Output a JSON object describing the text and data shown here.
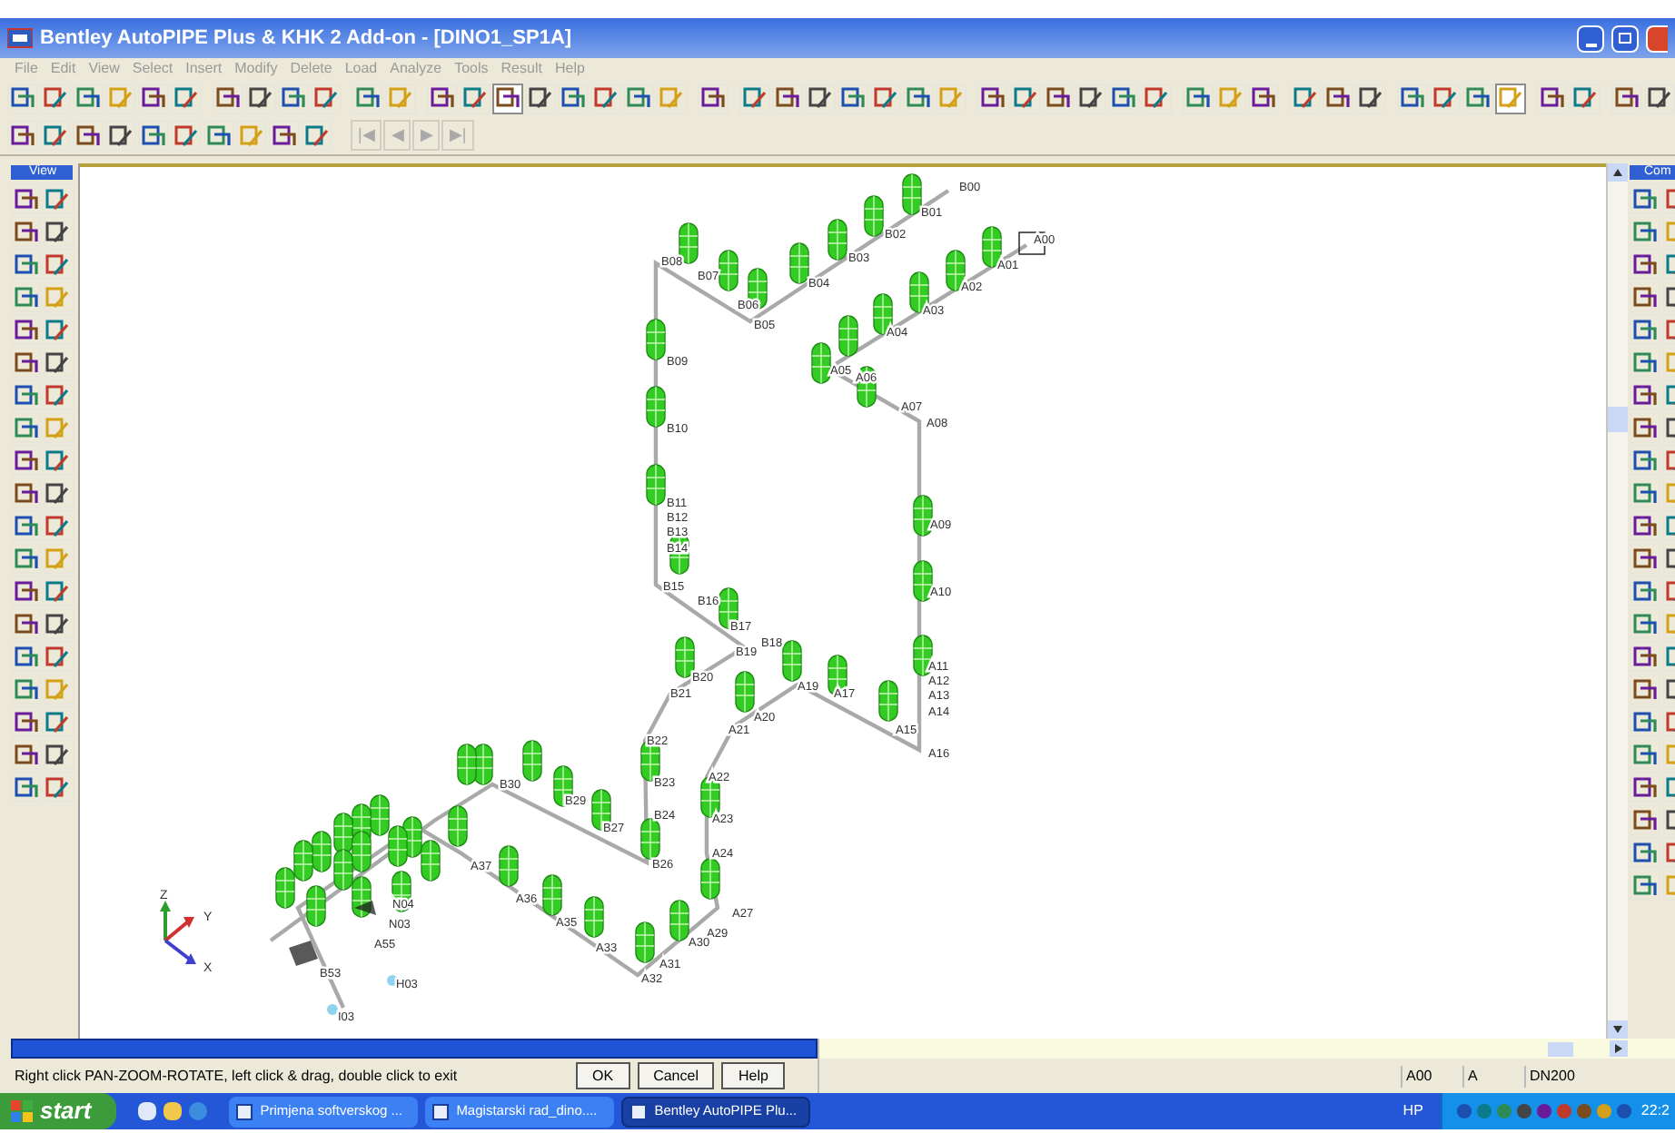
{
  "window": {
    "title": "Bentley AutoPIPE Plus & KHK 2 Add-on - [DINO1_SP1A]"
  },
  "menu": [
    "File",
    "Edit",
    "View",
    "Select",
    "Insert",
    "Modify",
    "Delete",
    "Load",
    "Analyze",
    "Tools",
    "Result",
    "Help"
  ],
  "toolbar_nav": [
    {
      "label": "|◀",
      "disabled": true
    },
    {
      "label": "◀",
      "disabled": true
    },
    {
      "label": "▶",
      "disabled": true
    },
    {
      "label": "▶|",
      "disabled": true
    }
  ],
  "left_panel": {
    "title": "View"
  },
  "right_panel": {
    "title": "Com"
  },
  "axes": [
    "Z",
    "Y",
    "X"
  ],
  "nodes": [
    {
      "label": "B00"
    },
    {
      "label": "B01"
    },
    {
      "label": "B02"
    },
    {
      "label": "B03"
    },
    {
      "label": "B04"
    },
    {
      "label": "B05"
    },
    {
      "label": "B06"
    },
    {
      "label": "B07"
    },
    {
      "label": "B08"
    },
    {
      "label": "B09"
    },
    {
      "label": "B10"
    },
    {
      "label": "B11"
    },
    {
      "label": "B12"
    },
    {
      "label": "B13"
    },
    {
      "label": "B14"
    },
    {
      "label": "B15"
    },
    {
      "label": "B16"
    },
    {
      "label": "B17"
    },
    {
      "label": "B18"
    },
    {
      "label": "B19"
    },
    {
      "label": "B20"
    },
    {
      "label": "B21"
    },
    {
      "label": "B22"
    },
    {
      "label": "B23"
    },
    {
      "label": "B24"
    },
    {
      "label": "B26"
    },
    {
      "label": "B27"
    },
    {
      "label": "B29"
    },
    {
      "label": "B30"
    },
    {
      "label": "A00"
    },
    {
      "label": "A01"
    },
    {
      "label": "A02"
    },
    {
      "label": "A03"
    },
    {
      "label": "A04"
    },
    {
      "label": "A05"
    },
    {
      "label": "A06"
    },
    {
      "label": "A07"
    },
    {
      "label": "A08"
    },
    {
      "label": "A09"
    },
    {
      "label": "A10"
    },
    {
      "label": "A11"
    },
    {
      "label": "A12"
    },
    {
      "label": "A13"
    },
    {
      "label": "A14"
    },
    {
      "label": "A15"
    },
    {
      "label": "A16"
    },
    {
      "label": "A17"
    },
    {
      "label": "A19"
    },
    {
      "label": "A20"
    },
    {
      "label": "A21"
    },
    {
      "label": "A22"
    },
    {
      "label": "A23"
    },
    {
      "label": "A24"
    },
    {
      "label": "A27"
    },
    {
      "label": "A29"
    },
    {
      "label": "A30"
    },
    {
      "label": "A31"
    },
    {
      "label": "A32"
    },
    {
      "label": "A33"
    },
    {
      "label": "A35"
    },
    {
      "label": "A36"
    },
    {
      "label": "A37"
    },
    {
      "label": "N04"
    },
    {
      "label": "N03"
    },
    {
      "label": "A55"
    },
    {
      "label": "B53"
    },
    {
      "label": "H03"
    },
    {
      "label": "I03"
    }
  ],
  "status_bar": {
    "message": "Right click PAN-ZOOM-ROTATE, left click & drag, double click to exit",
    "buttons": [
      "OK",
      "Cancel",
      "Help"
    ],
    "fields": [
      "A00",
      "A",
      "DN200"
    ]
  },
  "taskbar": {
    "start": "start",
    "tasks": [
      {
        "label": "Primjena softverskog ...",
        "selected": false
      },
      {
        "label": "Magistarski rad_dino....",
        "selected": false
      },
      {
        "label": "Bentley AutoPIPE Plu...",
        "selected": true
      }
    ],
    "tray_label": "HP",
    "clock": "22:2"
  }
}
